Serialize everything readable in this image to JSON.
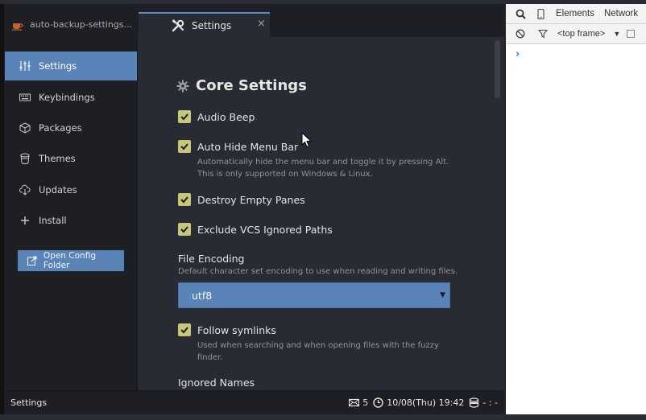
{
  "tabs": {
    "file_tab": "auto-backup-settings...",
    "settings_tab": "Settings",
    "close_glyph": "×"
  },
  "sidebar": {
    "items": [
      {
        "label": "Settings",
        "icon": "sliders-icon",
        "active": true
      },
      {
        "label": "Keybindings",
        "icon": "keyboard-icon",
        "active": false
      },
      {
        "label": "Packages",
        "icon": "package-icon",
        "active": false
      },
      {
        "label": "Themes",
        "icon": "paint-bucket-icon",
        "active": false
      },
      {
        "label": "Updates",
        "icon": "cloud-download-icon",
        "active": false
      },
      {
        "label": "Install",
        "icon": "plus-icon",
        "active": false
      }
    ],
    "open_config": "Open Config Folder"
  },
  "main": {
    "section_title": "Core Settings",
    "settings": [
      {
        "label": "Audio Beep",
        "checked": true,
        "description": ""
      },
      {
        "label": "Auto Hide Menu Bar",
        "checked": true,
        "description_lines": [
          "Automatically hide the menu bar and toggle it by pressing Alt.",
          "This is only supported on Windows & Linux."
        ]
      },
      {
        "label": "Destroy Empty Panes",
        "checked": true,
        "description": ""
      },
      {
        "label": "Exclude VCS Ignored Paths",
        "checked": true,
        "description": ""
      }
    ],
    "file_encoding": {
      "label": "File Encoding",
      "description": "Default character set encoding to use when reading and writing files.",
      "value": "utf8",
      "arrow": "▼"
    },
    "follow_symlinks": {
      "label": "Follow symlinks",
      "checked": true,
      "description_lines": [
        "Used when searching and when opening files with the fuzzy",
        "finder."
      ]
    },
    "ignored_names": {
      "label": "Ignored Names"
    }
  },
  "statusbar": {
    "left": "Settings",
    "mail_count": "5",
    "datetime": "10/08(Thu) 19:42",
    "extra": "- : -"
  },
  "devtools": {
    "tabs": [
      "Elements",
      "Network"
    ],
    "frame": "<top frame>",
    "frame_arrow": "▼",
    "prompt": "›"
  },
  "colors": {
    "accent": "#5a84b8",
    "checkbox": "#c7c67a",
    "panel": "#282b33",
    "sidebar": "#1d1f25"
  }
}
